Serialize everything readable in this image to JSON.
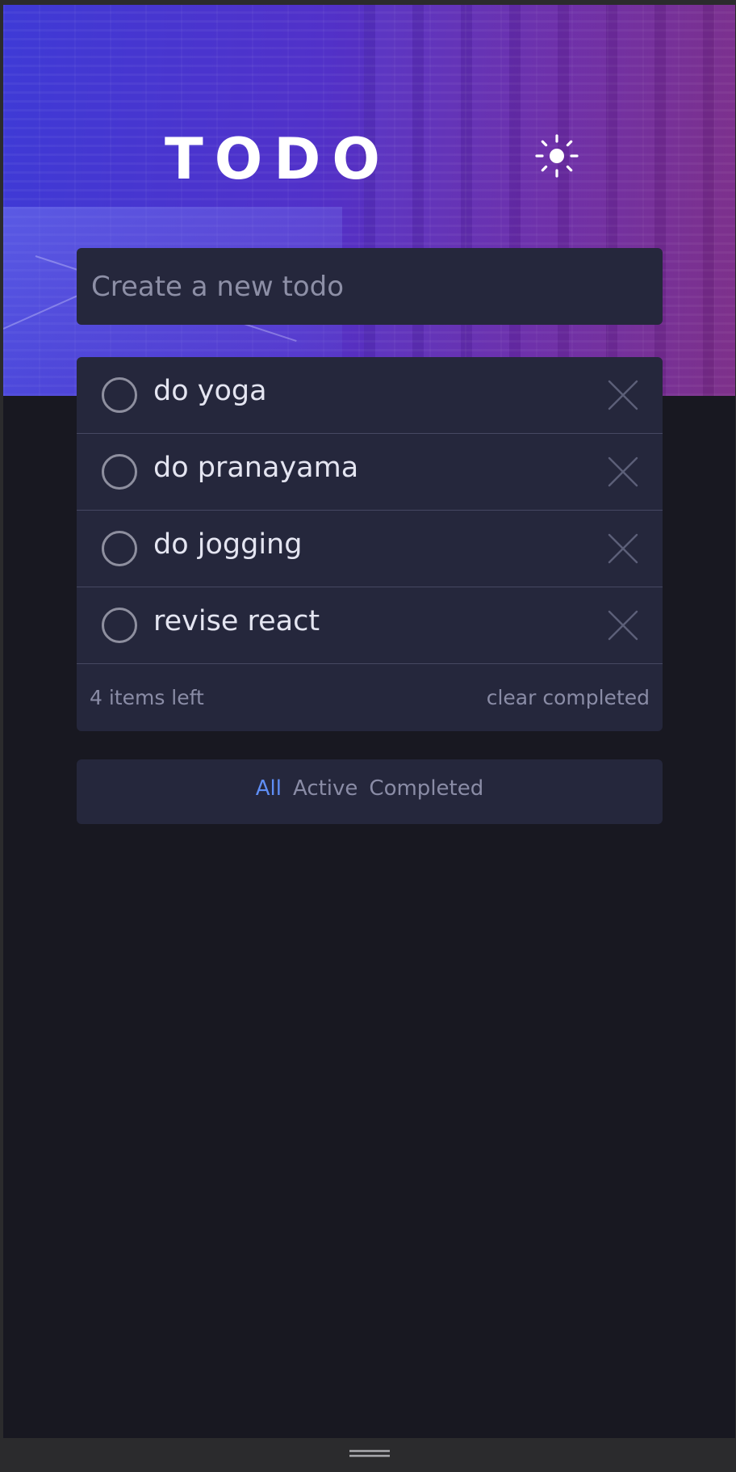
{
  "header": {
    "title": "TODO",
    "theme_icon": "sun-icon"
  },
  "new_todo": {
    "placeholder": "Create a new todo",
    "value": ""
  },
  "todos": [
    {
      "text": "do yoga",
      "completed": false
    },
    {
      "text": "do pranayama",
      "completed": false
    },
    {
      "text": "do jogging",
      "completed": false
    },
    {
      "text": "revise react",
      "completed": false
    }
  ],
  "footer": {
    "items_left": "4 items left",
    "clear_label": "clear completed"
  },
  "filters": {
    "all": "All",
    "active": "Active",
    "completed": "Completed",
    "selected": "all"
  },
  "colors": {
    "background": "#181821",
    "card": "#25273c",
    "accent": "#5f8ef5",
    "text": "#e4e5f1",
    "muted": "#8a8ca6"
  }
}
